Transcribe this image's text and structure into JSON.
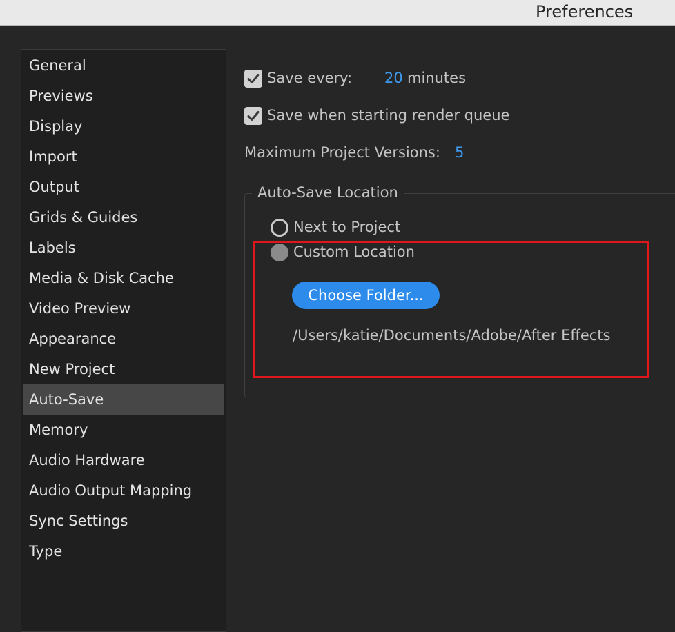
{
  "window": {
    "title": "Preferences"
  },
  "sidebar": {
    "items": [
      {
        "label": "General"
      },
      {
        "label": "Previews"
      },
      {
        "label": "Display"
      },
      {
        "label": "Import"
      },
      {
        "label": "Output"
      },
      {
        "label": "Grids & Guides"
      },
      {
        "label": "Labels"
      },
      {
        "label": "Media & Disk Cache"
      },
      {
        "label": "Video Preview"
      },
      {
        "label": "Appearance"
      },
      {
        "label": "New Project"
      },
      {
        "label": "Auto-Save"
      },
      {
        "label": "Memory"
      },
      {
        "label": "Audio Hardware"
      },
      {
        "label": "Audio Output Mapping"
      },
      {
        "label": "Sync Settings"
      },
      {
        "label": "Type"
      }
    ],
    "selected": "Auto-Save"
  },
  "autosave": {
    "save_every": {
      "label": "Save every:",
      "value": "20",
      "unit": "minutes",
      "checked": true
    },
    "save_render": {
      "label": "Save when starting render queue",
      "checked": true
    },
    "max_versions": {
      "label": "Maximum Project Versions:",
      "value": "5"
    },
    "location": {
      "legend": "Auto-Save Location",
      "next_to_project": "Next to Project",
      "custom_location": "Custom Location",
      "selected": "Custom Location",
      "choose_button": "Choose Folder...",
      "path": "/Users/katie/Documents/Adobe/After Effects"
    }
  },
  "colors": {
    "accent": "#2d8ceb",
    "value_blue": "#3d9cf2",
    "highlight": "#e0161b",
    "background": "#262626"
  }
}
